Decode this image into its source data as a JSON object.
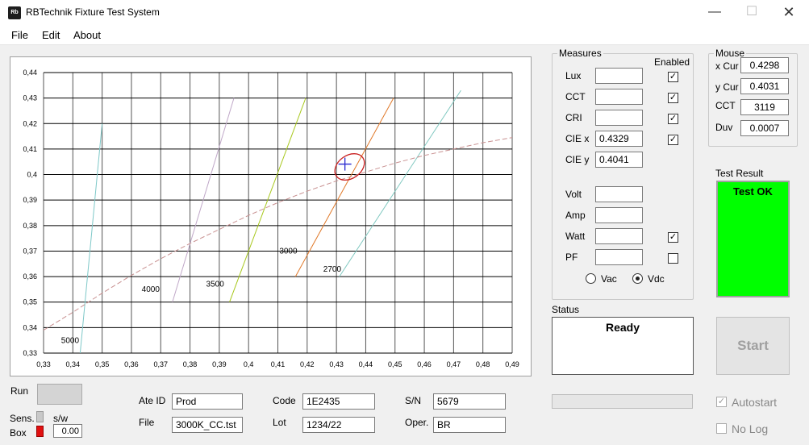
{
  "window": {
    "icon_text": "Rb",
    "title": "RBTechnik Fixture Test System",
    "min": "—",
    "max": "☐",
    "close": "✕"
  },
  "menu": [
    "File",
    "Edit",
    "About"
  ],
  "chart_data": {
    "type": "line",
    "x_ticks": [
      "0,33",
      "0,34",
      "0,35",
      "0,36",
      "0,37",
      "0,38",
      "0,39",
      "0,4",
      "0,41",
      "0,42",
      "0,43",
      "0,44",
      "0,45",
      "0,46",
      "0,47",
      "0,48",
      "0,49"
    ],
    "y_ticks": [
      "0,33",
      "0,34",
      "0,35",
      "0,36",
      "0,37",
      "0,38",
      "0,39",
      "0,4",
      "0,41",
      "0,42",
      "0,43",
      "0,44"
    ],
    "xlim": [
      0.33,
      0.49
    ],
    "ylim": [
      0.33,
      0.44
    ],
    "grid": true,
    "series": [
      {
        "name": "5000",
        "color": "#7ec8c8",
        "points": [
          [
            0.3425,
            0.33
          ],
          [
            0.35,
            0.42
          ]
        ]
      },
      {
        "name": "4000",
        "color": "#c0a8c8",
        "points": [
          [
            0.374,
            0.35
          ],
          [
            0.395,
            0.43
          ]
        ]
      },
      {
        "name": "3500",
        "color": "#a8c81e",
        "points": [
          [
            0.3935,
            0.35
          ],
          [
            0.4195,
            0.43
          ]
        ]
      },
      {
        "name": "3000",
        "color": "#e07828",
        "points": [
          [
            0.416,
            0.36
          ],
          [
            0.4495,
            0.43
          ]
        ]
      },
      {
        "name": "2700",
        "color": "#80c8c0",
        "points": [
          [
            0.431,
            0.36
          ],
          [
            0.4725,
            0.433
          ]
        ]
      },
      {
        "name": "",
        "color": "#c89090",
        "dashed": true,
        "points": [
          [
            0.33,
            0.339
          ],
          [
            0.34,
            0.346
          ],
          [
            0.35,
            0.3535
          ],
          [
            0.36,
            0.3605
          ],
          [
            0.37,
            0.367
          ],
          [
            0.38,
            0.373
          ],
          [
            0.39,
            0.3785
          ],
          [
            0.4,
            0.384
          ],
          [
            0.41,
            0.389
          ],
          [
            0.42,
            0.3935
          ],
          [
            0.43,
            0.3975
          ],
          [
            0.44,
            0.401
          ],
          [
            0.45,
            0.4045
          ],
          [
            0.46,
            0.4075
          ],
          [
            0.47,
            0.41
          ],
          [
            0.48,
            0.4125
          ],
          [
            0.49,
            0.4145
          ]
        ]
      }
    ],
    "annotations": [
      {
        "text": "5000",
        "x": 0.336,
        "y": 0.334
      },
      {
        "text": "4000",
        "x": 0.3635,
        "y": 0.354
      },
      {
        "text": "3500",
        "x": 0.3855,
        "y": 0.356
      },
      {
        "text": "3000",
        "x": 0.4105,
        "y": 0.369
      },
      {
        "text": "2700",
        "x": 0.4255,
        "y": 0.362
      }
    ],
    "target_ellipse": {
      "cx": 0.4345,
      "cy": 0.403,
      "rx": 0.0055,
      "ry": 0.0045,
      "color": "#c81e1e"
    },
    "measured_point": {
      "x": 0.4329,
      "y": 0.4041,
      "color": "#2828d0"
    }
  },
  "measures": {
    "title": "Measures",
    "enabled_header": "Enabled",
    "rows": [
      {
        "label": "Lux",
        "value": "",
        "enabled": true
      },
      {
        "label": "CCT",
        "value": "",
        "enabled": true
      },
      {
        "label": "CRI",
        "value": "",
        "enabled": true
      },
      {
        "label": "CIE x",
        "value": "0.4329",
        "enabled": true
      },
      {
        "label": "CIE y",
        "value": "0.4041"
      },
      {
        "label": "Volt",
        "value": ""
      },
      {
        "label": "Amp",
        "value": ""
      },
      {
        "label": "Watt",
        "value": "",
        "enabled": true
      },
      {
        "label": "PF",
        "value": "",
        "enabled": false
      }
    ],
    "vac_label": "Vac",
    "vdc_label": "Vdc",
    "vdc_selected": true
  },
  "mouse": {
    "title": "Mouse",
    "xcur_label": "x Cur",
    "xcur": "0.4298",
    "ycur_label": "y Cur",
    "ycur": "0.4031",
    "cct_label": "CCT",
    "cct": "3119",
    "duv_label": "Duv",
    "duv": "0.0007"
  },
  "test_result": {
    "label": "Test Result",
    "text": "Test OK",
    "color": "#00ff00"
  },
  "status": {
    "label": "Status",
    "text": "Ready"
  },
  "start_button": "Start",
  "autostart": {
    "label": "Autostart",
    "checked": true
  },
  "nolog": {
    "label": "No Log",
    "checked": false
  },
  "run": {
    "label": "Run"
  },
  "sens": {
    "label": "Sens.",
    "sw_label": "s/w"
  },
  "box": {
    "label": "Box",
    "value": "0.00"
  },
  "fields": {
    "ate_id_label": "Ate ID",
    "ate_id": "Prod",
    "file_label": "File",
    "file": "3000K_CC.tst",
    "code_label": "Code",
    "code": "1E2435",
    "lot_label": "Lot",
    "lot": "1234/22",
    "sn_label": "S/N",
    "sn": "5679",
    "oper_label": "Oper.",
    "oper": "BR"
  }
}
